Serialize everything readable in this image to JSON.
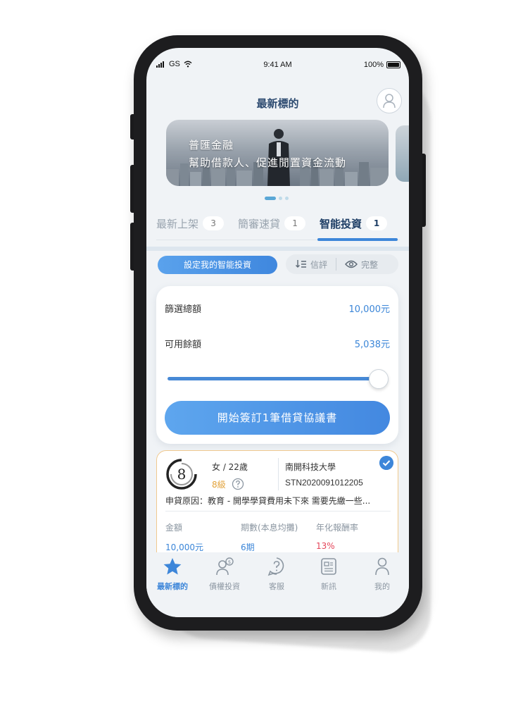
{
  "status_bar": {
    "carrier": "GS",
    "time": "9:41 AM",
    "battery": "100%"
  },
  "header": {
    "title": "最新標的",
    "avatar_icon": "user-icon"
  },
  "banner": {
    "line1": "普匯金融",
    "line2": "幫助借款人、促進閒置資金流動",
    "page_count": 3,
    "active_page": 1
  },
  "tabs": [
    {
      "label": "最新上架",
      "count": "3",
      "active": false
    },
    {
      "label": "簡審速貸",
      "count": "1",
      "active": false
    },
    {
      "label": "智能投資",
      "count": "1",
      "active": true
    }
  ],
  "actions": {
    "set_smart": "設定我的智能投資",
    "credit": "信評",
    "complete": "完整"
  },
  "summary": {
    "filter_total_label": "篩選總額",
    "filter_total_value": "10,000元",
    "available_label": "可用餘額",
    "available_value": "5,038元",
    "slider_fraction": 1.0,
    "cta_label": "開始簽訂1筆借貸協議書"
  },
  "loan": {
    "logo_text": "8",
    "gender_age": "女 / 22歲",
    "grade": "8級",
    "school": "南開科技大學",
    "id": "STN2020091012205",
    "reason": "申貸原因：教育 - 開學學貸費用未下來 需要先繳一些...",
    "columns": [
      {
        "header": "金額",
        "value": "10,000元",
        "highlight": false
      },
      {
        "header": "期數(本息均攤)",
        "value": "6期",
        "highlight": false
      },
      {
        "header": "年化報酬率",
        "value": "13%",
        "highlight": true
      }
    ]
  },
  "bottom_nav": [
    {
      "label": "最新標的",
      "icon": "star-icon",
      "active": true
    },
    {
      "label": "債權投資",
      "icon": "investor-icon",
      "active": false
    },
    {
      "label": "客服",
      "icon": "help-icon",
      "active": false
    },
    {
      "label": "新訊",
      "icon": "news-icon",
      "active": false
    },
    {
      "label": "我的",
      "icon": "profile-icon",
      "active": false
    }
  ],
  "colors": {
    "accent": "#3d86d9",
    "title": "#2c4a70",
    "rate_red": "#e4455a",
    "grade_orange": "#e2a23a"
  }
}
